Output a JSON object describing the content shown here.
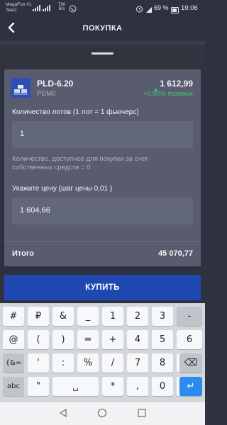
{
  "status_bar": {
    "carrier1": "MegaFon #1",
    "carrier2": "Tele2",
    "speed_value": "790",
    "speed_unit": "B/s",
    "battery": "69 %",
    "time": "19:06"
  },
  "header": {
    "title": "ПОКУПКА"
  },
  "instrument": {
    "ticker": "PLD-6.20",
    "code": "PDM0",
    "price": "1 612,99",
    "change": "+0,90% годовых"
  },
  "form": {
    "lots_label": "Количество лотов (1 лот = 1 фьючерс)",
    "lots_value": "1",
    "available_note_line1": "Количество, доступное для покупки за счет",
    "available_note_line2": "собственных средств = 0",
    "price_label": "Укажите цену (шаг цены 0,01 )",
    "price_value": "1 604,66"
  },
  "total": {
    "label": "Итого",
    "value": "45 070,77"
  },
  "buy_button": {
    "label": "КУПИТЬ"
  },
  "keyboard": {
    "rows": [
      [
        "#",
        "₽",
        "&",
        "_",
        "1",
        "2",
        "3",
        "-"
      ],
      [
        "@",
        "(",
        ")",
        "=",
        "+",
        "4",
        "5",
        "6"
      ],
      [
        "{&=",
        "'",
        ":",
        "%",
        "/",
        "7",
        "8",
        "9"
      ],
      [
        "abc",
        "\"",
        "␣",
        "*",
        ",",
        "0",
        ".",
        "↵"
      ]
    ],
    "backspace": "⌫"
  },
  "colors": {
    "accent": "#1f49b0",
    "positive": "#3fc57a",
    "background": "#2e3140",
    "card": "#585c6e"
  }
}
